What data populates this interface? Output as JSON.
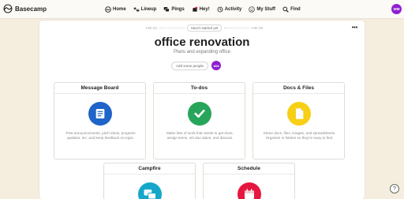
{
  "app": {
    "name": "Basecamp"
  },
  "nav": {
    "items": [
      {
        "label": "Home",
        "icon": "basecamp-home-icon"
      },
      {
        "label": "Lineup",
        "icon": "lineup-icon"
      },
      {
        "label": "Pings",
        "icon": "pings-icon"
      },
      {
        "label": "Hey!",
        "icon": "hey-icon"
      },
      {
        "label": "Activity",
        "icon": "activity-icon"
      },
      {
        "label": "My Stuff",
        "icon": "my-stuff-icon"
      },
      {
        "label": "Find",
        "icon": "find-icon"
      }
    ],
    "avatar_initials": "WM"
  },
  "project": {
    "timeline": {
      "start": "Feb 22",
      "status": "Hasn't started yet",
      "end": "Feb 28"
    },
    "title": "office renovation",
    "description": "Plans and expanding office",
    "add_people_label": "Add some people",
    "member_initials": "WM"
  },
  "tools": [
    {
      "title": "Message Board",
      "icon": "message-board-icon",
      "color": "#1f64c8",
      "desc": "Post announcements, pitch ideas, progress updates, etc. and keep feedback on-topic."
    },
    {
      "title": "To-dos",
      "icon": "checkmark-icon",
      "color": "#27a55a",
      "desc": "Make lists of work that needs to get done, assign items, set due dates, and discuss."
    },
    {
      "title": "Docs & Files",
      "icon": "document-icon",
      "color": "#f7cf15",
      "desc": "Share docs, files, images, and spreadsheets. Organize in folders so they're easy to find."
    },
    {
      "title": "Campfire",
      "icon": "chat-bubbles-icon",
      "color": "#14a7c9",
      "desc": ""
    },
    {
      "title": "Schedule",
      "icon": "calendar-icon",
      "color": "#e5173e",
      "desc": ""
    }
  ],
  "help": {
    "label": "?"
  }
}
